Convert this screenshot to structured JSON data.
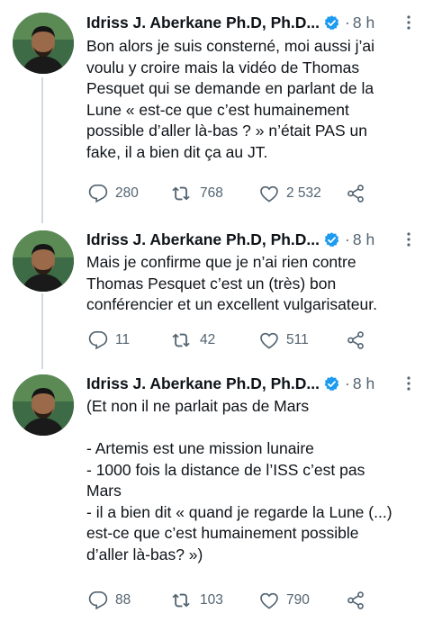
{
  "tweets": [
    {
      "author": "Idriss J. Aberkane Ph.D, Ph.D...",
      "time": "8 h",
      "text": "Bon alors je suis consterné, moi aussi j’ai\nvoulu y croire mais la vidéo de Thomas\nPesquet qui se demande en parlant de la\nLune « est-ce que c’est humainement\npossible d’aller là-bas ? » n’était PAS un\nfake, il a bien dit ça au JT.",
      "replies": "280",
      "retweets": "768",
      "likes": "2 532"
    },
    {
      "author": "Idriss J. Aberkane Ph.D, Ph.D...",
      "time": "8 h",
      "text": "Mais je confirme que je n’ai rien contre\nThomas Pesquet c’est un (très) bon\nconférencier et un excellent vulgarisateur.",
      "replies": "11",
      "retweets": "42",
      "likes": "511"
    },
    {
      "author": "Idriss J. Aberkane Ph.D, Ph.D...",
      "time": "8 h",
      "text": "(Et non il ne parlait pas de Mars\n\n- Artemis est une mission lunaire\n- 1000 fois la distance de l’ISS c’est pas\nMars\n- il a bien dit « quand je regarde la Lune (...)\nest-ce que c’est humainement possible\nd’aller là-bas? »)",
      "replies": "88",
      "retweets": "103",
      "likes": "790"
    }
  ],
  "separator": "·",
  "icons": {
    "verified": "verified-badge-icon",
    "more": "more-vertical-icon",
    "reply": "reply-icon",
    "retweet": "retweet-icon",
    "like": "heart-icon",
    "share": "share-icon"
  },
  "colors": {
    "text": "#0f1419",
    "muted": "#536471",
    "verified": "#1d9bf0",
    "thread_line": "#cfd9de"
  }
}
